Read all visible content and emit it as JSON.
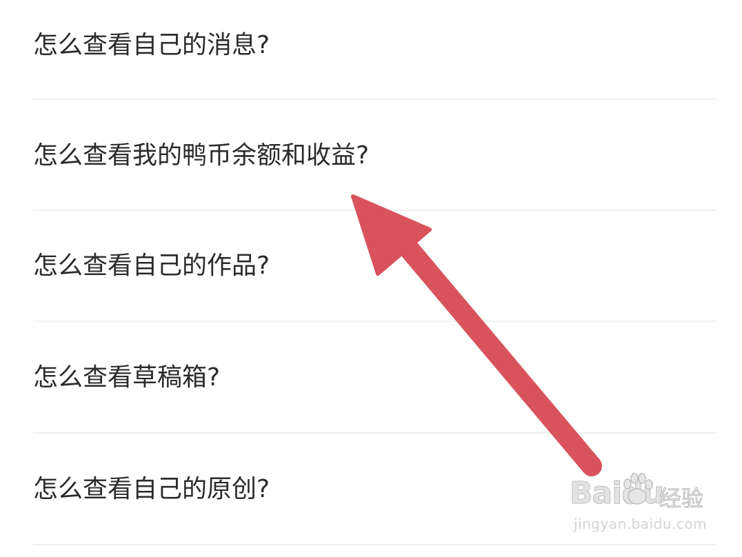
{
  "faq": {
    "items": [
      {
        "label": "怎么查看自己的消息?"
      },
      {
        "label": "怎么查看我的鸭币余额和收益?"
      },
      {
        "label": "怎么查看自己的作品?"
      },
      {
        "label": "怎么查看草稿箱?"
      },
      {
        "label": "怎么查看自己的原创?"
      }
    ]
  },
  "annotation": {
    "arrow_color": "#d9535c",
    "points_to_item": 1
  },
  "watermark": {
    "brand": "Bai",
    "brand_suffix": "du",
    "product": "经验",
    "url": "jingyan.baidu.com"
  }
}
